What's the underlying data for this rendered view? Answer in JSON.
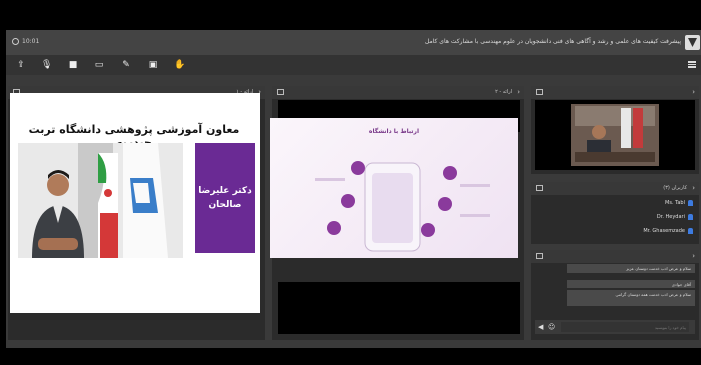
{
  "window": {
    "clock": "10:01",
    "title": "پیشرفت کیفیت های علمی و رشد و آگاهی های فنی دانشجویان در علوم مهندسی با مشارکت های کامل",
    "toolbar_icons": [
      "share-screen-icon",
      "microphone-icon",
      "camera-icon",
      "screen-icon",
      "pen-icon",
      "whiteboard-icon",
      "raise-hand-icon"
    ],
    "menu_icon": "hamburger-menu-icon"
  },
  "panels": {
    "left": {
      "label": "ارائه - ۱"
    },
    "middle": {
      "label": "ارائه - ۲"
    },
    "video": {
      "label": ""
    },
    "users": {
      "label": "کاربران (۳)"
    },
    "chat": {
      "label": ""
    }
  },
  "slide1": {
    "title": "معاون آموزشی پژوهشی دانشگاه تربت حیدریه",
    "name_line1": "دکتر علیرضا",
    "name_line2": "صالحان"
  },
  "slide2": {
    "title": "ارتباط با دانشگاه"
  },
  "users": [
    {
      "name": "Ms. Tabl"
    },
    {
      "name": "Dr. Heydari"
    },
    {
      "name": "Mr. Ghasemzade"
    }
  ],
  "chat": {
    "messages": [
      "سلام و عرض ادب خدمت دوستان عزیز",
      "آقای جوادی",
      "سلام و عرض ادب خدمت همه دوستان گرامی"
    ],
    "input_placeholder": "پیام خود را بنویسید"
  }
}
